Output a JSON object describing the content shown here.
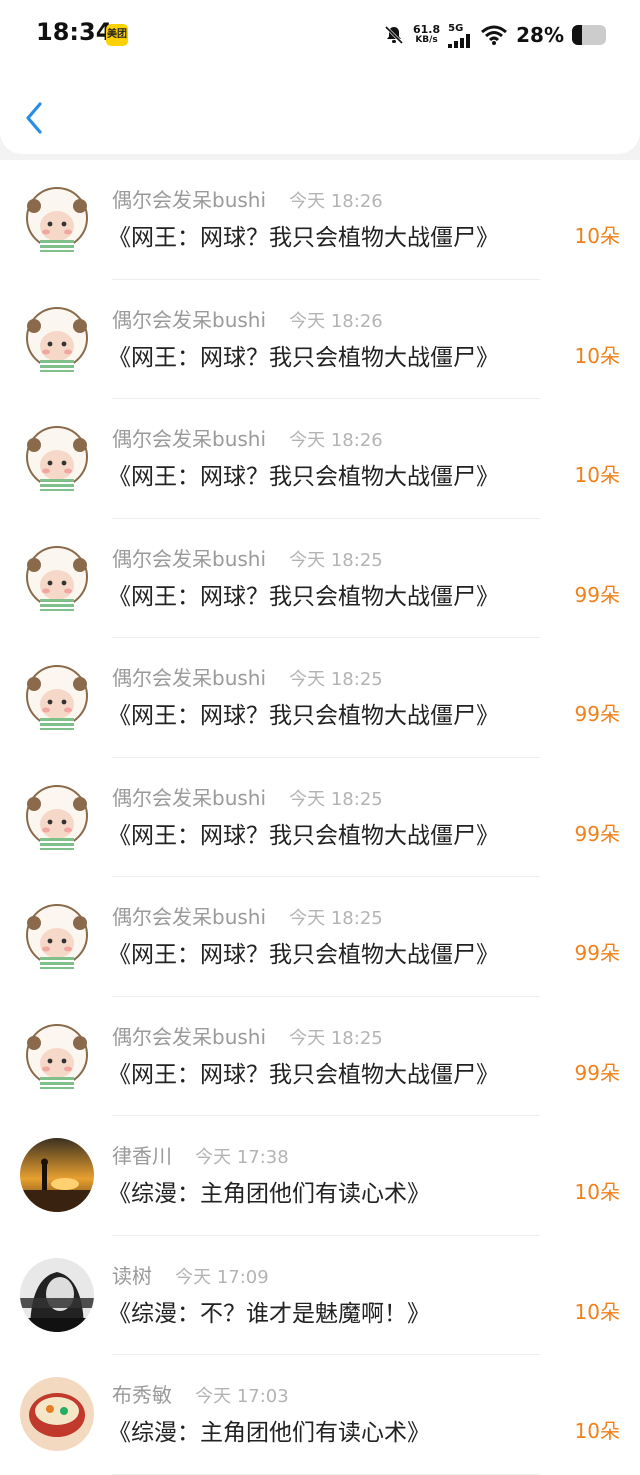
{
  "status_bar": {
    "time": "18:34",
    "app_badge": "美团",
    "net_speed_value": "61.8",
    "net_speed_unit": "KB/s",
    "network": "5G",
    "battery_percent": "28%",
    "battery_level": 0.28
  },
  "nav": {
    "back_icon": "chevron-left-icon"
  },
  "rewards": [
    {
      "user": "偶尔会发呆bushi",
      "time": "今天 18:26",
      "book": "《网王：网球？我只会植物大战僵尸》",
      "amount": "10朵",
      "avatar": "sheep"
    },
    {
      "user": "偶尔会发呆bushi",
      "time": "今天 18:26",
      "book": "《网王：网球？我只会植物大战僵尸》",
      "amount": "10朵",
      "avatar": "sheep"
    },
    {
      "user": "偶尔会发呆bushi",
      "time": "今天 18:26",
      "book": "《网王：网球？我只会植物大战僵尸》",
      "amount": "10朵",
      "avatar": "sheep"
    },
    {
      "user": "偶尔会发呆bushi",
      "time": "今天 18:25",
      "book": "《网王：网球？我只会植物大战僵尸》",
      "amount": "99朵",
      "avatar": "sheep"
    },
    {
      "user": "偶尔会发呆bushi",
      "time": "今天 18:25",
      "book": "《网王：网球？我只会植物大战僵尸》",
      "amount": "99朵",
      "avatar": "sheep"
    },
    {
      "user": "偶尔会发呆bushi",
      "time": "今天 18:25",
      "book": "《网王：网球？我只会植物大战僵尸》",
      "amount": "99朵",
      "avatar": "sheep"
    },
    {
      "user": "偶尔会发呆bushi",
      "time": "今天 18:25",
      "book": "《网王：网球？我只会植物大战僵尸》",
      "amount": "99朵",
      "avatar": "sheep"
    },
    {
      "user": "偶尔会发呆bushi",
      "time": "今天 18:25",
      "book": "《网王：网球？我只会植物大战僵尸》",
      "amount": "99朵",
      "avatar": "sheep"
    },
    {
      "user": "律香川",
      "time": "今天 17:38",
      "book": "《综漫：主角团他们有读心术》",
      "amount": "10朵",
      "avatar": "sunset"
    },
    {
      "user": "读树",
      "time": "今天 17:09",
      "book": "《综漫：不？谁才是魅魔啊！》",
      "amount": "10朵",
      "avatar": "portrait"
    },
    {
      "user": "布秀敏",
      "time": "今天 17:03",
      "book": "《综漫：主角团他们有读心术》",
      "amount": "10朵",
      "avatar": "bowl"
    }
  ],
  "colors": {
    "amount": "#f0801a",
    "back_icon": "#2a8ee6"
  }
}
